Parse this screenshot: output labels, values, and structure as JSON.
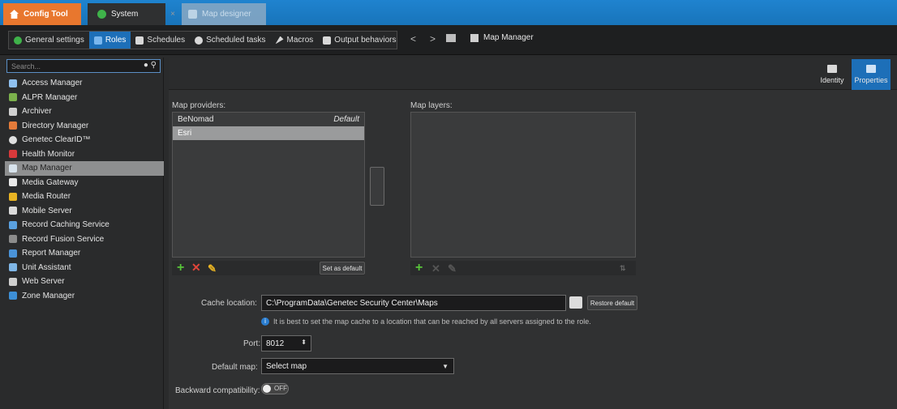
{
  "colors": {
    "accent": "#1d6fb8",
    "config_tab": "#e8772e",
    "add_green": "#58c33a",
    "remove_red": "#e0453a",
    "edit_yellow": "#e8b323"
  },
  "title_tabs": [
    {
      "label": "Config Tool",
      "icon": "home-icon"
    },
    {
      "label": "System",
      "icon": "system-icon"
    },
    {
      "label": "Map designer",
      "icon": "map-designer-icon"
    }
  ],
  "toolbar": {
    "items": [
      {
        "label": "General settings",
        "icon": "settings-icon"
      },
      {
        "label": "Roles",
        "icon": "roles-icon"
      },
      {
        "label": "Schedules",
        "icon": "calendar-icon"
      },
      {
        "label": "Scheduled tasks",
        "icon": "tasks-icon"
      },
      {
        "label": "Macros",
        "icon": "macro-icon"
      },
      {
        "label": "Output behaviors",
        "icon": "output-icon"
      }
    ],
    "back": "<",
    "forward": ">",
    "current": "Map Manager"
  },
  "sidebar": {
    "search_placeholder": "Search...",
    "roles": [
      {
        "label": "Access Manager",
        "icon": "access-manager-icon"
      },
      {
        "label": "ALPR Manager",
        "icon": "alpr-icon"
      },
      {
        "label": "Archiver",
        "icon": "archiver-icon"
      },
      {
        "label": "Directory Manager",
        "icon": "directory-icon"
      },
      {
        "label": "Genetec ClearID™",
        "icon": "clearid-icon"
      },
      {
        "label": "Health Monitor",
        "icon": "health-icon"
      },
      {
        "label": "Map Manager",
        "icon": "map-icon"
      },
      {
        "label": "Media Gateway",
        "icon": "gateway-icon"
      },
      {
        "label": "Media Router",
        "icon": "router-icon"
      },
      {
        "label": "Mobile Server",
        "icon": "mobile-icon"
      },
      {
        "label": "Record Caching Service",
        "icon": "record-cache-icon"
      },
      {
        "label": "Record Fusion Service",
        "icon": "record-fusion-icon"
      },
      {
        "label": "Report Manager",
        "icon": "report-icon"
      },
      {
        "label": "Unit Assistant",
        "icon": "unit-assistant-icon"
      },
      {
        "label": "Web Server",
        "icon": "web-server-icon"
      },
      {
        "label": "Zone Manager",
        "icon": "zone-icon"
      }
    ],
    "selected": "Map Manager"
  },
  "main": {
    "side_tabs": [
      {
        "label": "Identity",
        "icon": "identity-icon"
      },
      {
        "label": "Properties",
        "icon": "properties-icon"
      }
    ],
    "map_providers_label": "Map providers:",
    "map_layers_label": "Map layers:",
    "providers": [
      {
        "name": "BeNomad",
        "tag": "Default"
      },
      {
        "name": "Esri",
        "tag": ""
      }
    ],
    "set_as_default": "Set as default",
    "cache_location_label": "Cache location:",
    "cache_location_value": "C:\\ProgramData\\Genetec Security Center\\Maps",
    "restore_default": "Restore default",
    "cache_hint": "It is best to set the map cache to a location that can be reached by all servers assigned to the role.",
    "port_label": "Port:",
    "port_value": "8012",
    "default_map_label": "Default map:",
    "default_map_value": "Select map",
    "backward_label": "Backward compatibility:",
    "backward_value": "OFF"
  }
}
